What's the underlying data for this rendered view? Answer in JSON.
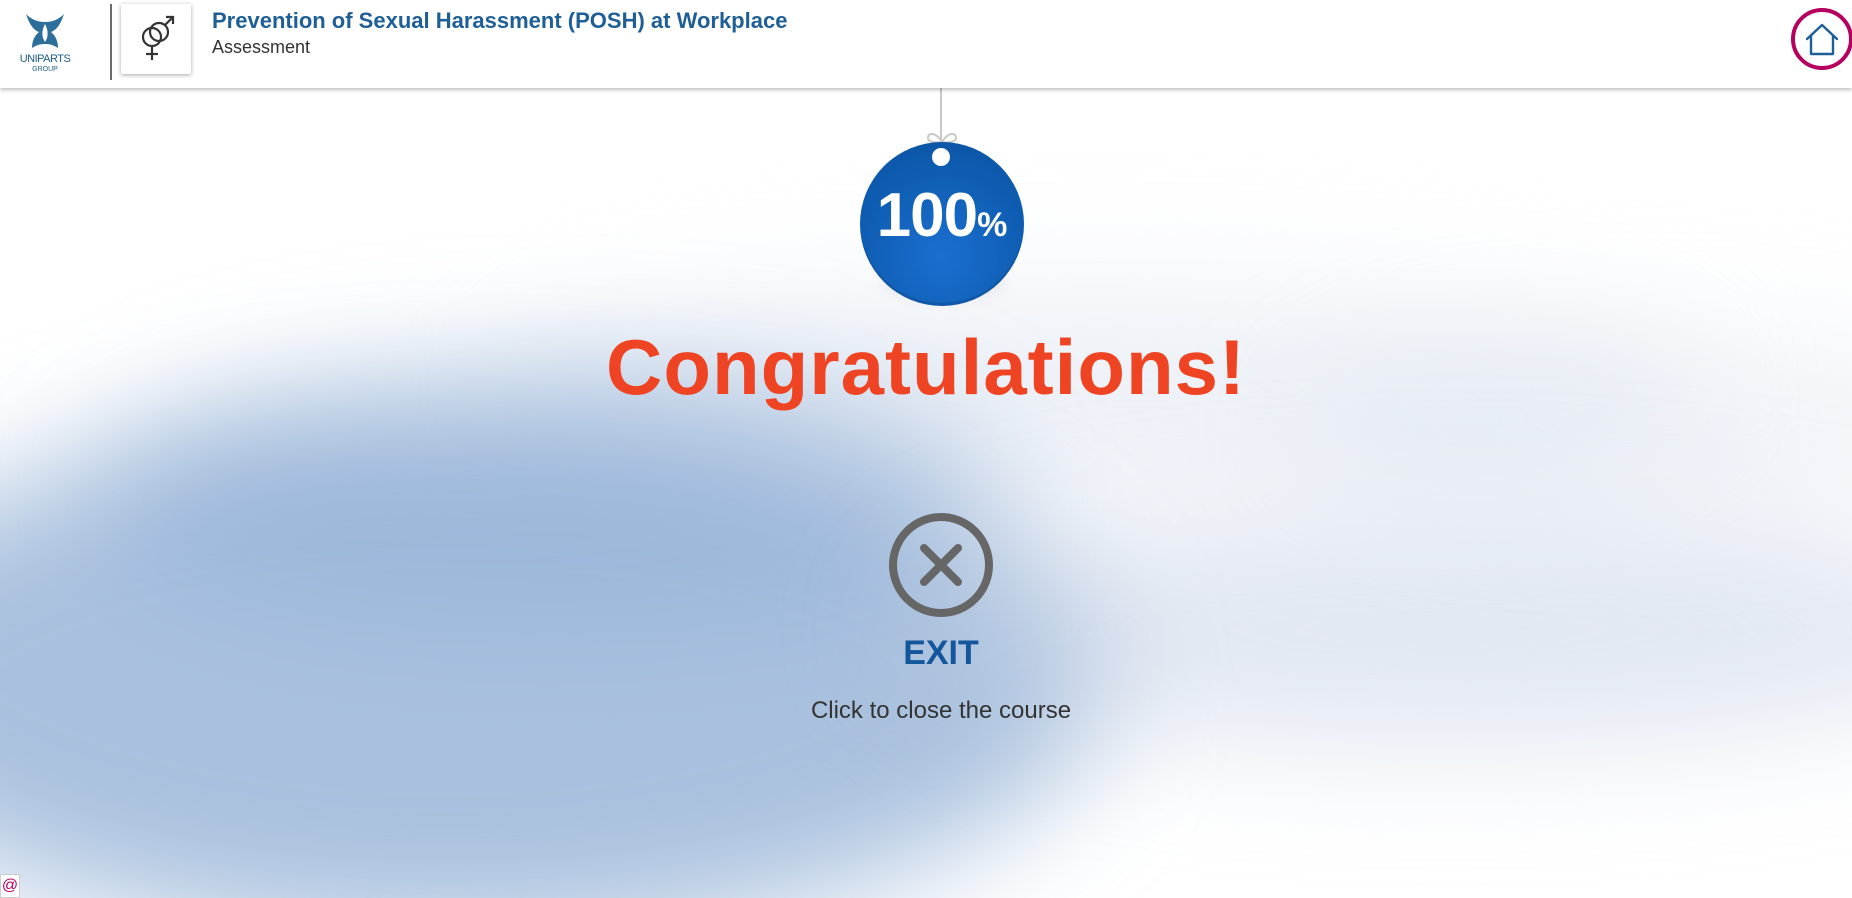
{
  "header": {
    "logo_text": "UNIPARTS",
    "logo_subtext": "GROUP",
    "course_icon": "gender-symbols-icon",
    "course_title": "Prevention of Sexual Harassment (POSH) at Workplace",
    "course_subtitle": "Assessment",
    "home_icon": "home-icon"
  },
  "result": {
    "score_value": "100",
    "score_unit": "%",
    "message": "Congratulations!"
  },
  "exit": {
    "icon": "close-circle-icon",
    "label": "EXIT",
    "description": "Click to close the course"
  },
  "corner_badge": "@",
  "colors": {
    "title": "#1f5f95",
    "congrats": "#ef4423",
    "badge": "#0d5aae",
    "exit_label": "#14569b",
    "home_ring": "#b5005f"
  }
}
